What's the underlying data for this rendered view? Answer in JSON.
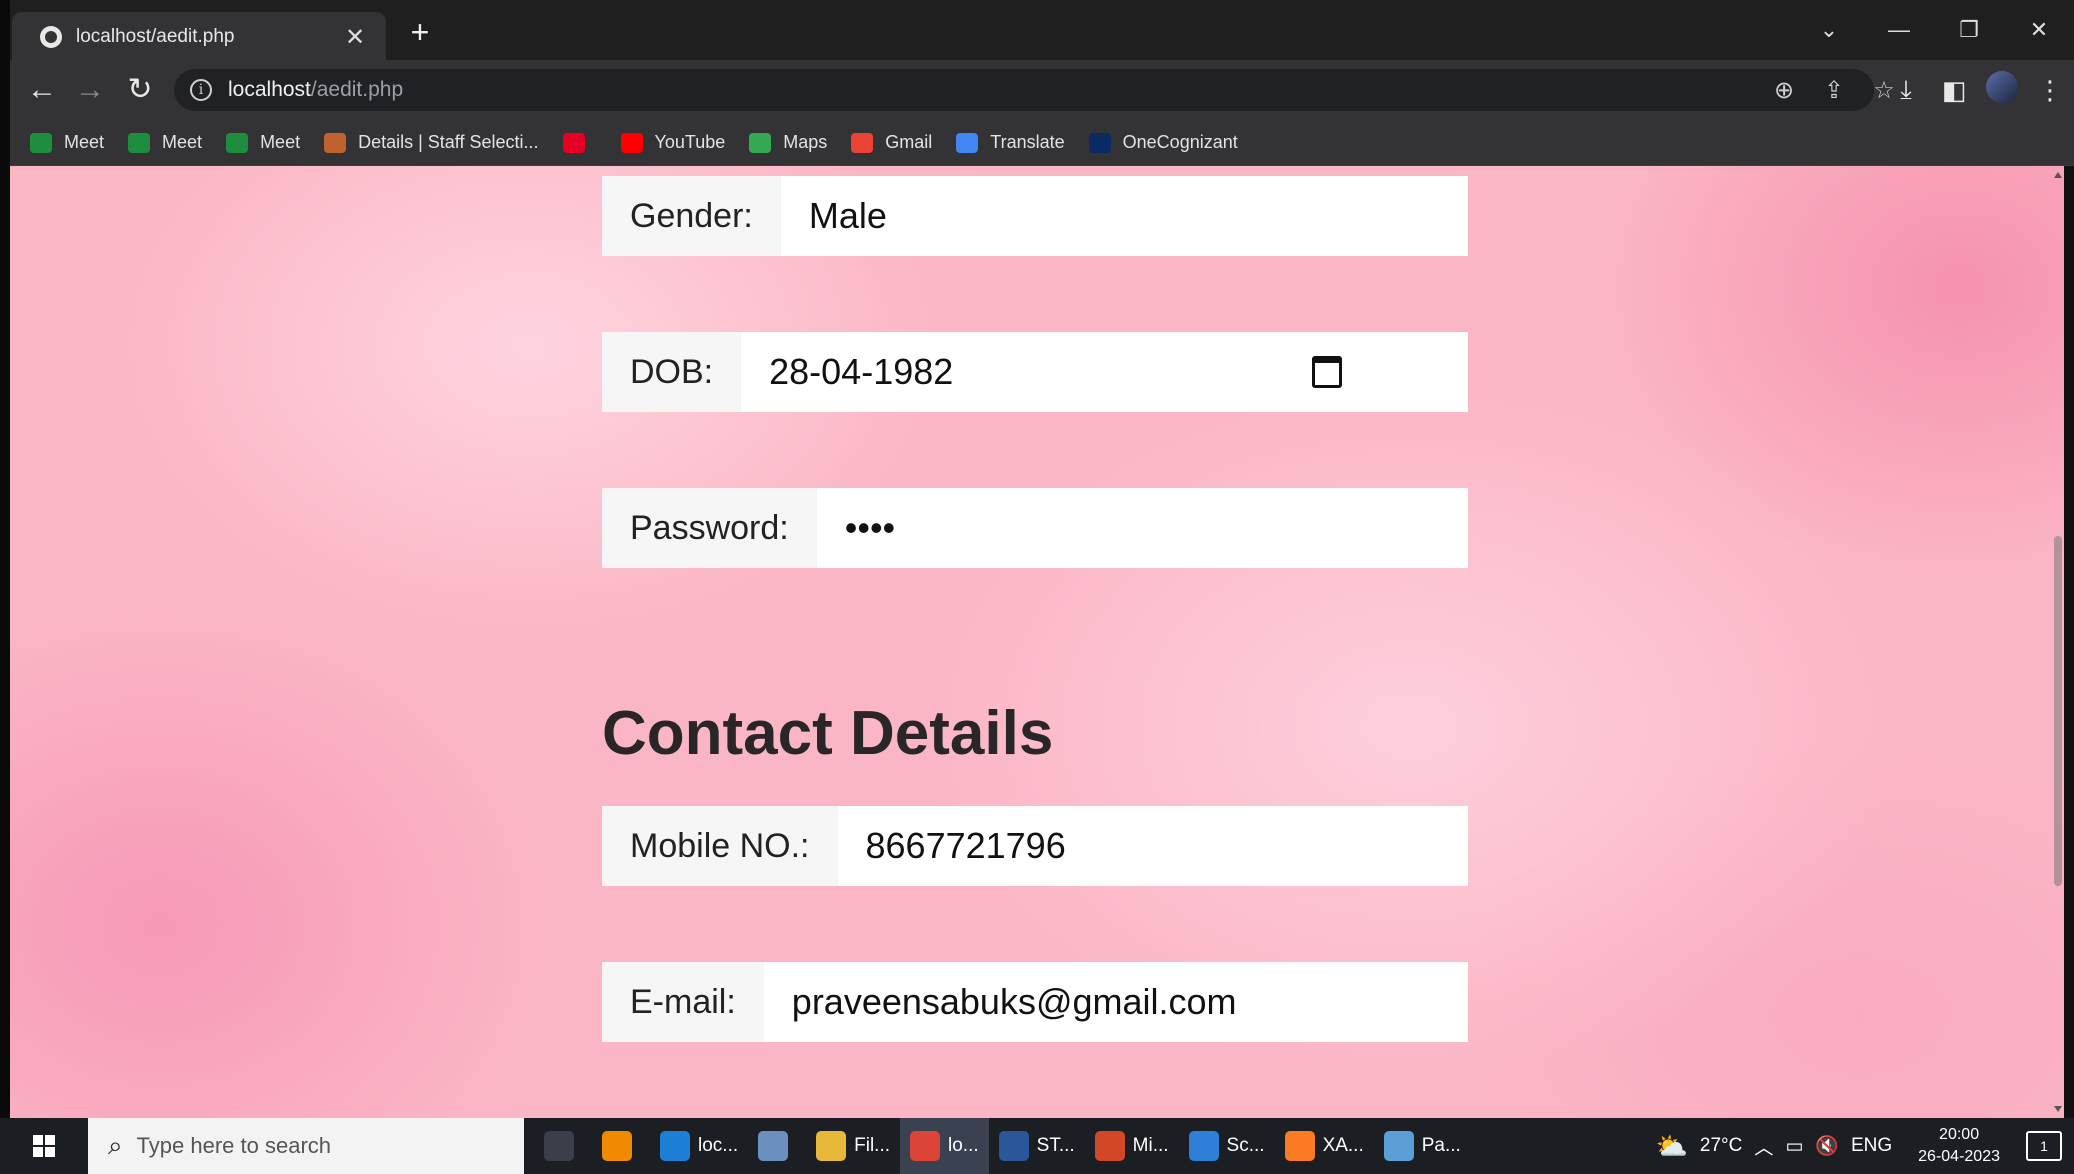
{
  "browser": {
    "tab_title": "localhost/aedit.php",
    "tab_close": "✕",
    "new_tab": "+",
    "url_host": "localhost",
    "url_path": "/aedit.php",
    "icons": [
      "zoom-icon",
      "share-icon",
      "star-icon",
      "download-icon",
      "sidebar-icon",
      "profile-avatar",
      "menu-icon"
    ]
  },
  "bookmarks": [
    {
      "label": "Meet",
      "color": "#1e8e3e"
    },
    {
      "label": "Meet",
      "color": "#1e8e3e"
    },
    {
      "label": "Meet",
      "color": "#1e8e3e"
    },
    {
      "label": "Details | Staff Selecti...",
      "color": "#c0622d"
    },
    {
      "label": "",
      "color": "#e60023"
    },
    {
      "label": "YouTube",
      "color": "#ff0000"
    },
    {
      "label": "Maps",
      "color": "#34a853"
    },
    {
      "label": "Gmail",
      "color": "#ea4335"
    },
    {
      "label": "Translate",
      "color": "#4285f4"
    },
    {
      "label": "OneCognizant",
      "color": "#0a2a66"
    }
  ],
  "form": {
    "gender_label": "Gender:",
    "gender_value": "Male",
    "dob_label": "DOB:",
    "dob_value": "28-04-1982",
    "password_label": "Password:",
    "password_value": "••••",
    "section_title": "Contact Details",
    "mobile_label": "Mobile NO.:",
    "mobile_value": "8667721796",
    "email_label": "E-mail:",
    "email_value": "praveensabuks@gmail.com"
  },
  "taskbar": {
    "search_placeholder": "Type here to search",
    "apps": [
      {
        "label": "",
        "color": "#3a3f4a"
      },
      {
        "label": "",
        "color": "#f08a00"
      },
      {
        "label": "loc...",
        "color": "#1e7fd6"
      },
      {
        "label": "",
        "color": "#6b8fbf"
      },
      {
        "label": "Fil...",
        "color": "#e8b83a"
      },
      {
        "label": "lo...",
        "color": "#db4437"
      },
      {
        "label": "ST...",
        "color": "#2b579a"
      },
      {
        "label": "Mi...",
        "color": "#d24726"
      },
      {
        "label": "Sc...",
        "color": "#2f7ed8"
      },
      {
        "label": "XA...",
        "color": "#fb7a24"
      },
      {
        "label": "Pa...",
        "color": "#5aa0d6"
      }
    ],
    "weather": "27°C",
    "language": "ENG",
    "time": "20:00",
    "date": "26-04-2023",
    "notifications": "1"
  }
}
